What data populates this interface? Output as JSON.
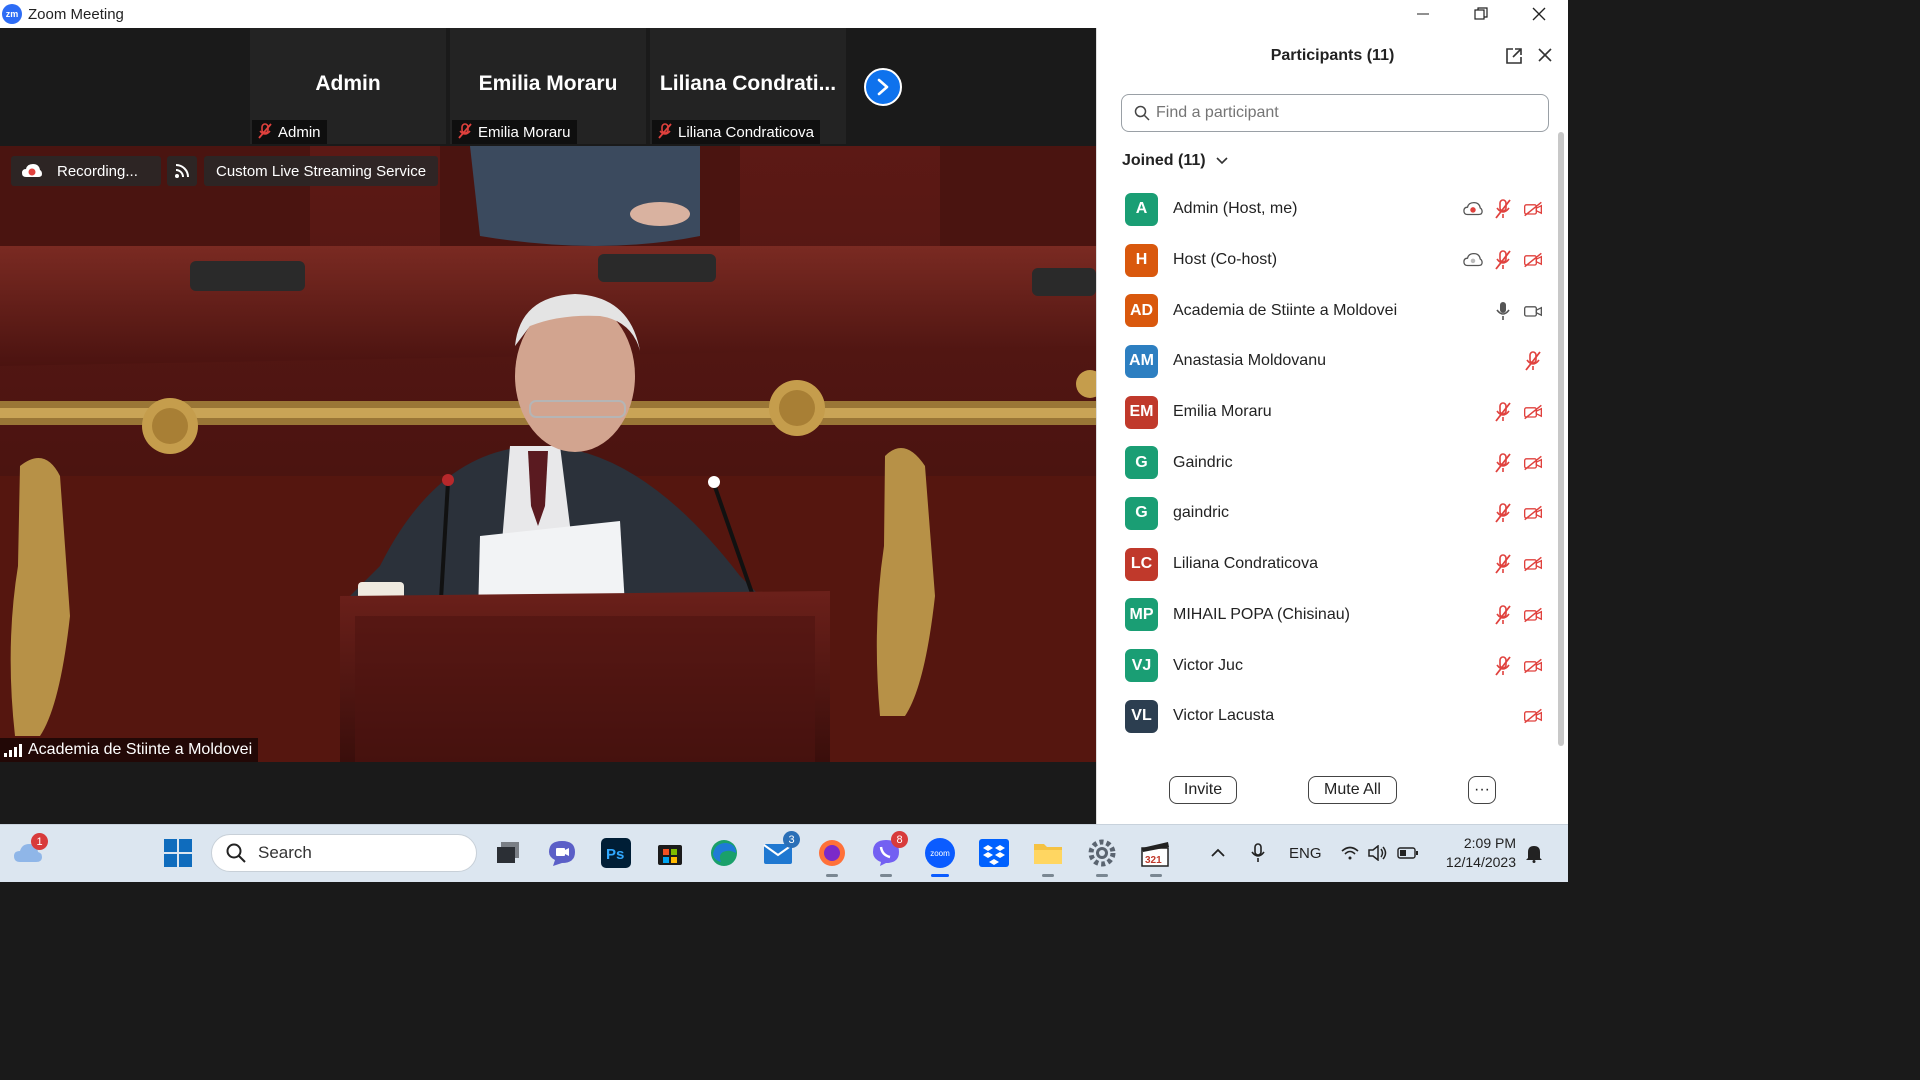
{
  "window": {
    "title": "Zoom Meeting",
    "app_logo": "zm"
  },
  "thumbnails": [
    {
      "display_name": "Admin",
      "label": "Admin"
    },
    {
      "display_name": "Emilia Moraru",
      "label": "Emilia Moraru"
    },
    {
      "display_name": "Liliana  Condrati...",
      "label": "Liliana Condraticova"
    }
  ],
  "video": {
    "recording_label": "Recording...",
    "streaming_label": "Custom Live Streaming Service",
    "speaker_label": "Academia de Stiinte a Moldovei"
  },
  "participants_panel": {
    "title": "Participants (11)",
    "search_placeholder": "Find a participant",
    "joined_label": "Joined (11)",
    "participants": [
      {
        "initials": "A",
        "name": "Admin (Host, me)",
        "color": "#1a9e74",
        "icons": [
          "cloud-record-icon",
          "mic-muted-icon",
          "video-off-icon"
        ]
      },
      {
        "initials": "H",
        "name": "Host (Co-host)",
        "color": "#d9580d",
        "icons": [
          "cloud-icon",
          "mic-muted-icon",
          "video-off-icon"
        ]
      },
      {
        "initials": "AD",
        "name": "Academia de Stiinte a Moldovei",
        "color": "#d9580d",
        "icons": [
          "mic-icon",
          "video-icon"
        ]
      },
      {
        "initials": "AM",
        "name": "Anastasia Moldovanu",
        "color": "#2d7fc1",
        "icons": [
          "mic-muted-icon"
        ]
      },
      {
        "initials": "EM",
        "name": "Emilia Moraru",
        "color": "#c0392b",
        "icons": [
          "mic-muted-icon",
          "video-off-icon"
        ]
      },
      {
        "initials": "G",
        "name": "Gaindric",
        "color": "#1a9e74",
        "icons": [
          "mic-muted-icon",
          "video-off-icon"
        ]
      },
      {
        "initials": "G",
        "name": "gaindric",
        "color": "#1a9e74",
        "icons": [
          "mic-muted-icon",
          "video-off-icon"
        ]
      },
      {
        "initials": "LC",
        "name": "Liliana Condraticova",
        "color": "#c0392b",
        "icons": [
          "mic-muted-icon",
          "video-off-icon"
        ]
      },
      {
        "initials": "MP",
        "name": "MIHAIL POPA (Chisinau)",
        "color": "#1a9e74",
        "icons": [
          "mic-muted-icon",
          "video-off-icon"
        ]
      },
      {
        "initials": "VJ",
        "name": "Victor Juc",
        "color": "#1a9e74",
        "icons": [
          "mic-muted-icon",
          "video-off-icon"
        ]
      },
      {
        "initials": "VL",
        "name": "Victor Lacusta",
        "color": "#2c3e50",
        "icons": [
          "video-off-icon"
        ]
      }
    ],
    "buttons": {
      "invite": "Invite",
      "mute_all": "Mute All",
      "more": "···"
    }
  },
  "taskbar": {
    "search_label": "Search",
    "weather_badge": "1",
    "mail_badge": "3",
    "viber_badge": "8",
    "language": "ENG",
    "time": "2:09 PM",
    "date": "12/14/2023",
    "zoom_label": "zoom"
  }
}
